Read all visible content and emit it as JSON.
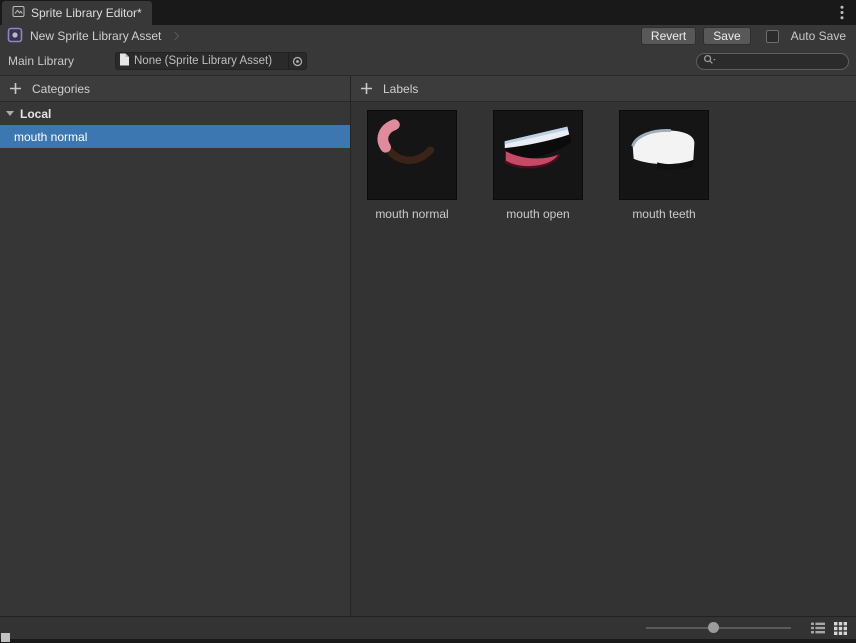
{
  "window": {
    "title": "Sprite Library Editor*",
    "tab_icon": "sprite-library-icon",
    "menu_icon": "kebab-menu-icon"
  },
  "toolbar": {
    "asset_icon": "sprite-library-asset-icon",
    "breadcrumb": "New Sprite Library Asset",
    "revert": "Revert",
    "save": "Save",
    "auto_save": "Auto Save",
    "auto_save_checked": false
  },
  "library_bar": {
    "label": "Main Library",
    "object_icon": "asset-file-icon",
    "object_value": "None (Sprite Library Asset)",
    "picker_icon": "object-picker-icon",
    "search_icon": "search-icon",
    "search_value": ""
  },
  "categories": {
    "add_icon": "plus-icon",
    "title": "Categories",
    "group": "Local",
    "foldout_icon": "foldout-arrow-icon",
    "items": [
      {
        "label": "mouth normal",
        "selected": true
      }
    ]
  },
  "labels": {
    "add_icon": "plus-icon",
    "title": "Labels",
    "cards": [
      {
        "label": "mouth normal",
        "sprite": "smile-curve-sprite"
      },
      {
        "label": "mouth open",
        "sprite": "open-mouth-sprite"
      },
      {
        "label": "mouth teeth",
        "sprite": "teeth-sprite"
      }
    ]
  },
  "footer": {
    "zoom": 0.43,
    "list_view_icon": "list-view-icon",
    "grid_view_icon": "grid-view-icon"
  },
  "colors": {
    "selection_blue": "#3D77B2",
    "window_bg": "#383838",
    "tabbar_bg": "#191919",
    "thumb_bg": "#151515",
    "sprite_pink": "#E08B9B",
    "sprite_brown": "#3C2318",
    "sprite_crimson": "#C64A66",
    "sprite_dark_red": "#4A0F1D",
    "sprite_white": "#F3F3F3",
    "sprite_light_blue": "#BCD2E4"
  }
}
